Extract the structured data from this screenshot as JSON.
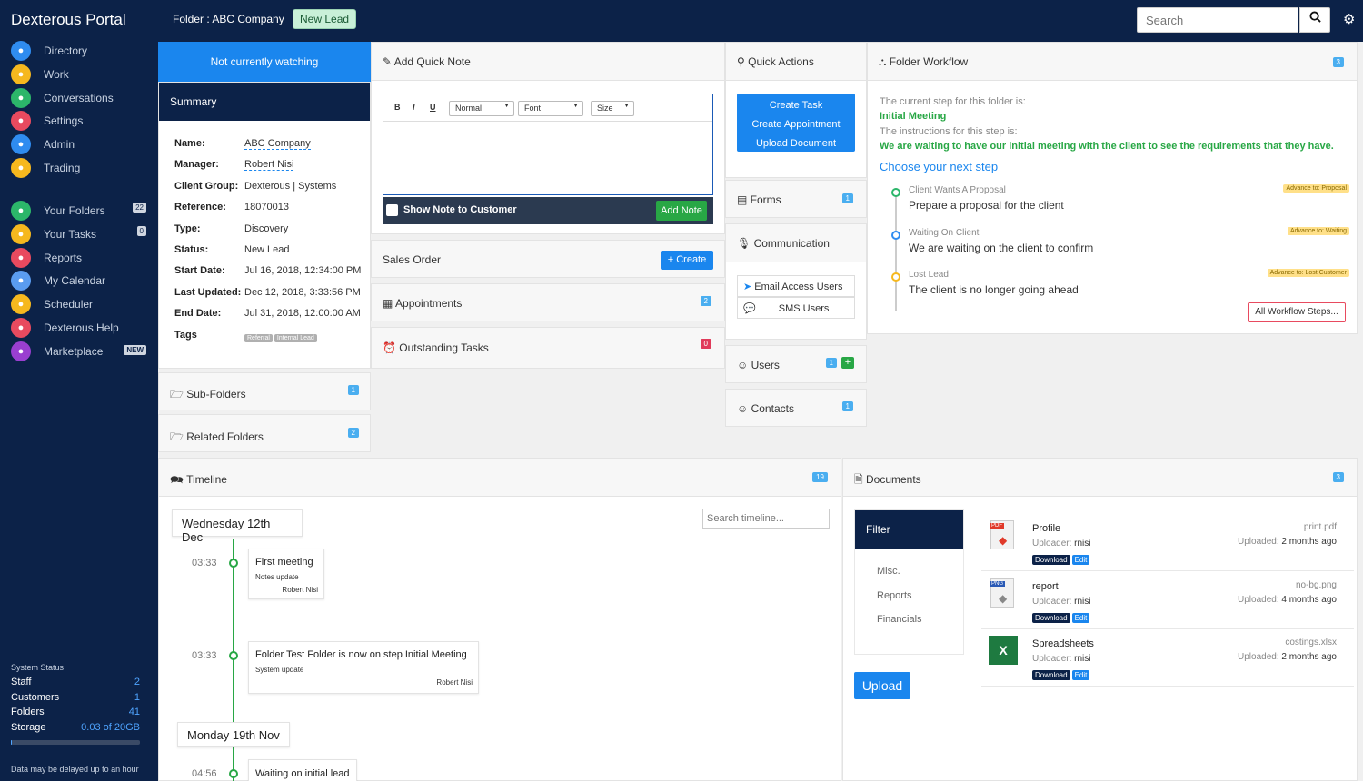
{
  "app": {
    "title": "Dexterous Portal",
    "folder_label": "Folder : ABC Company",
    "lead_badge": "New Lead",
    "search_placeholder": "Search"
  },
  "sidebar": {
    "main_items": [
      {
        "label": "Directory",
        "icon": "directory-icon",
        "color": "#2f8cf0"
      },
      {
        "label": "Work",
        "icon": "work-icon",
        "color": "#f6b81e"
      },
      {
        "label": "Conversations",
        "icon": "chat-icon",
        "color": "#2cb66a"
      },
      {
        "label": "Settings",
        "icon": "gear-icon",
        "color": "#e84a5f"
      },
      {
        "label": "Admin",
        "icon": "admin-icon",
        "color": "#2f8cf0"
      },
      {
        "label": "Trading",
        "icon": "truck-icon",
        "color": "#f6b81e"
      }
    ],
    "sub_items": [
      {
        "label": "Your Folders",
        "icon": "folder-icon",
        "color": "#2cb66a",
        "count": "22"
      },
      {
        "label": "Your Tasks",
        "icon": "tasks-icon",
        "color": "#f6b81e",
        "count": "0"
      },
      {
        "label": "Reports",
        "icon": "reports-icon",
        "color": "#e84a5f"
      },
      {
        "label": "My Calendar",
        "icon": "calendar-icon",
        "color": "#5a9cf0"
      },
      {
        "label": "Scheduler",
        "icon": "scheduler-icon",
        "color": "#f6b81e"
      },
      {
        "label": "Dexterous Help",
        "icon": "help-icon",
        "color": "#e84a5f"
      },
      {
        "label": "Marketplace",
        "icon": "cart-icon",
        "color": "#9a3fd0",
        "new": "NEW"
      }
    ],
    "system_status": {
      "title": "System Status",
      "rows": [
        {
          "label": "Staff",
          "value": "2"
        },
        {
          "label": "Customers",
          "value": "1"
        },
        {
          "label": "Folders",
          "value": "41"
        },
        {
          "label": "Storage",
          "value": "0.03 of 20GB"
        }
      ],
      "storage_used_fraction": 0.0015,
      "note": "Data may be delayed up to an hour"
    }
  },
  "watch": {
    "label": "Not currently watching"
  },
  "summary": {
    "title": "Summary",
    "fields": [
      {
        "label": "Name:",
        "value": "ABC Company"
      },
      {
        "label": "Manager:",
        "value": "Robert Nisi"
      },
      {
        "label": "Client Group:",
        "value": "Dexterous | Systems"
      },
      {
        "label": "Reference:",
        "value": "18070013"
      },
      {
        "label": "Type:",
        "value": "Discovery"
      },
      {
        "label": "Status:",
        "value": "New Lead"
      },
      {
        "label": "Start Date:",
        "value": "Jul 16, 2018, 12:34:00 PM"
      },
      {
        "label": "Last Updated:",
        "value": "Dec 12, 2018, 3:33:56 PM"
      },
      {
        "label": "End Date:",
        "value": "Jul 31, 2018, 12:00:00 AM"
      }
    ],
    "tags_label": "Tags",
    "tags": [
      "Referral",
      "Internal Lead"
    ]
  },
  "subfolders": {
    "title": "Sub-Folders",
    "count": "1"
  },
  "related": {
    "title": "Related Folders",
    "count": "2"
  },
  "quicknote": {
    "title": "Add Quick Note",
    "toolbar": {
      "bold": "B",
      "italic": "I",
      "underline": "U",
      "format": "Normal",
      "font": "Font",
      "size": "Size"
    },
    "show_label": "Show Note to Customer",
    "add_label": "Add Note"
  },
  "sales": {
    "title": "Sales Order",
    "create": "Create"
  },
  "appointments": {
    "title": "Appointments",
    "count": "2"
  },
  "tasks": {
    "title": "Outstanding Tasks",
    "count": "0"
  },
  "quick_actions": {
    "title": "Quick Actions",
    "buttons": [
      "Create Task",
      "Create Appointment",
      "Upload Document"
    ]
  },
  "forms": {
    "title": "Forms",
    "count": "1"
  },
  "communication": {
    "title": "Communication",
    "email": "Email Access Users",
    "sms": "SMS Users"
  },
  "users": {
    "title": "Users",
    "count": "1"
  },
  "contacts": {
    "title": "Contacts",
    "count": "1"
  },
  "workflow": {
    "title": "Folder Workflow",
    "count": "3",
    "intro": "The current step for this folder is:",
    "current_step": "Initial Meeting",
    "instr_label": "The instructions for this step is:",
    "instructions": "We are waiting to have our initial meeting with the client to see the requirements that they have.",
    "choose": "Choose your next step",
    "steps": [
      {
        "name": "Client Wants A Proposal",
        "desc": "Prepare a proposal for the client",
        "advance": "Advance to: Proposal",
        "color": "#2cb66a"
      },
      {
        "name": "Waiting On Client",
        "desc": "We are waiting on the client to confirm",
        "advance": "Advance to: Waiting",
        "color": "#2f8cf0"
      },
      {
        "name": "Lost Lead",
        "desc": "The client is no longer going ahead",
        "advance": "Advance to: Lost Customer",
        "color": "#f6b81e"
      }
    ],
    "all_steps": "All Workflow Steps..."
  },
  "timeline": {
    "title": "Timeline",
    "count": "19",
    "search_placeholder": "Search timeline...",
    "days": [
      {
        "date": "Wednesday 12th Dec",
        "entries": [
          {
            "time": "03:33",
            "title": "First meeting",
            "sub": "Notes update",
            "author": "Robert Nisi"
          },
          {
            "time": "03:33",
            "title": "Folder Test Folder is now on step Initial Meeting",
            "sub": "System update",
            "author": "Robert Nisi"
          }
        ]
      },
      {
        "date": "Monday 19th Nov",
        "entries": [
          {
            "time": "04:56",
            "title": "Waiting on initial lead"
          }
        ]
      }
    ]
  },
  "documents": {
    "title": "Documents",
    "count": "3",
    "filter": {
      "title": "Filter",
      "items": [
        "Misc.",
        "Reports",
        "Financials"
      ]
    },
    "upload": "Upload",
    "uploader_label": "Uploader:",
    "uploaded_label": "Uploaded:",
    "download": "Download",
    "edit": "Edit",
    "items": [
      {
        "name": "Profile",
        "uploader": "rnisi",
        "file": "print.pdf",
        "uploaded": "2 months ago",
        "icon": "pdf-icon",
        "type": "PDF"
      },
      {
        "name": "report",
        "uploader": "rnisi",
        "file": "no-bg.png",
        "uploaded": "4 months ago",
        "icon": "png-icon",
        "type": "PNG"
      },
      {
        "name": "Spreadsheets",
        "uploader": "rnisi",
        "file": "costings.xlsx",
        "uploaded": "2 months ago",
        "icon": "excel-icon",
        "type": "X"
      }
    ]
  }
}
